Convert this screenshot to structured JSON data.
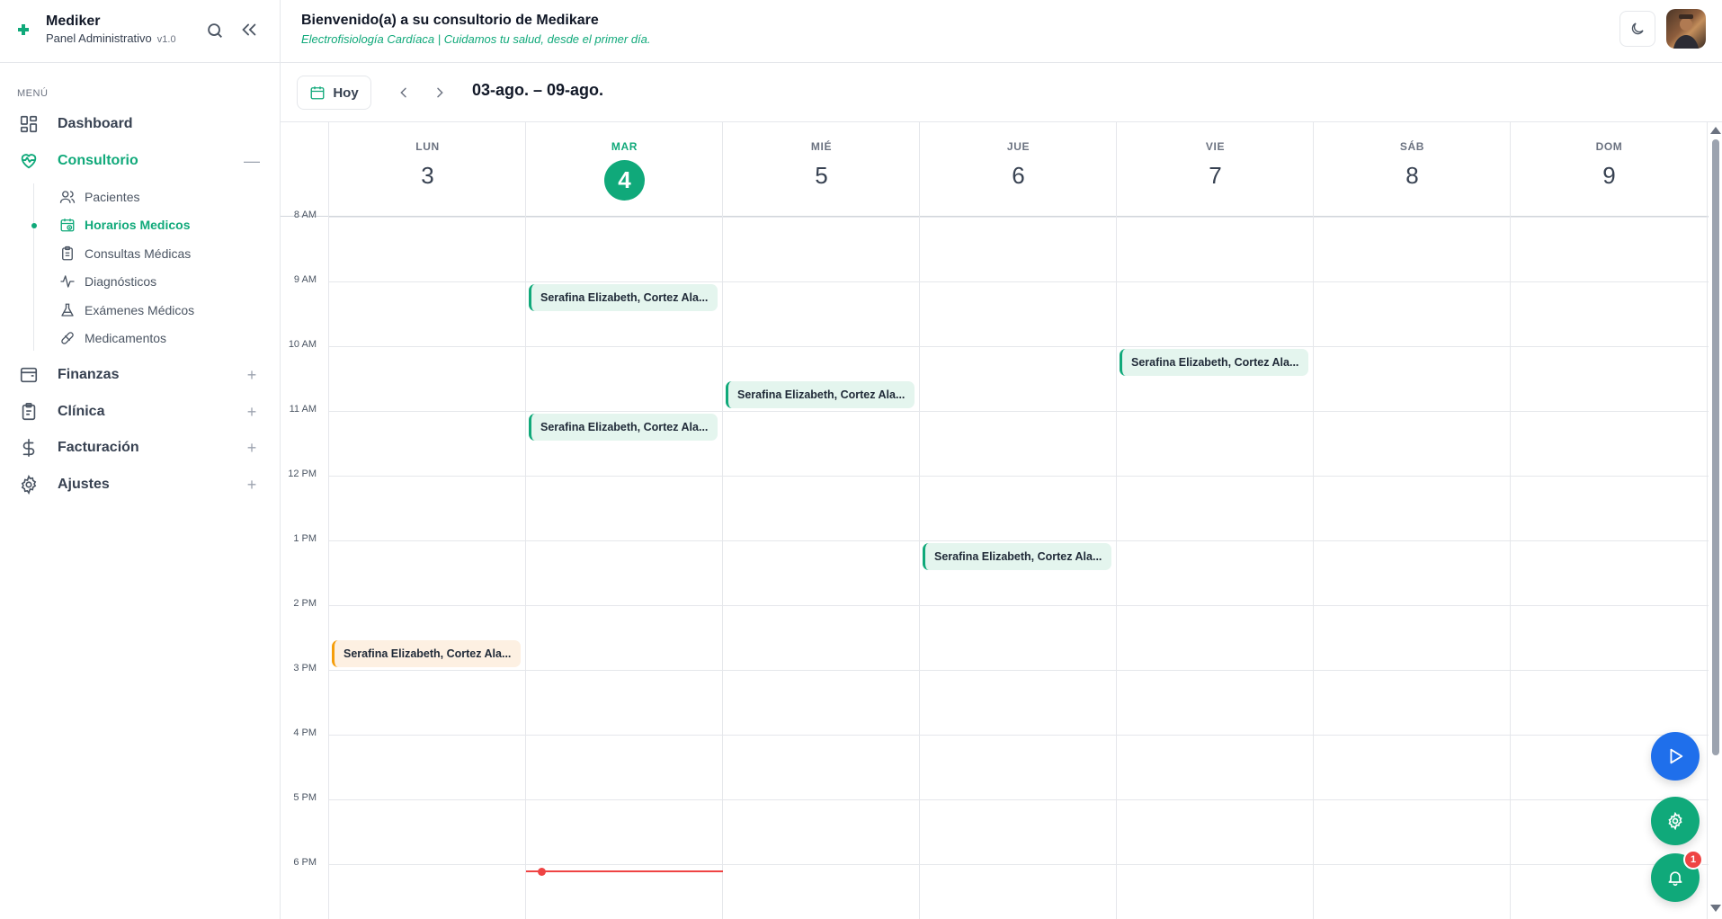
{
  "brand": {
    "name": "Mediker",
    "subtitle": "Panel Administrativo",
    "version": "v1.0"
  },
  "sidebar": {
    "menu_label": "MENÚ",
    "items": [
      {
        "label": "Dashboard",
        "icon": "dashboard-icon"
      },
      {
        "label": "Consultorio",
        "icon": "heart-pulse-icon",
        "toggle": "—"
      },
      {
        "label": "Finanzas",
        "icon": "wallet-icon",
        "toggle": "+"
      },
      {
        "label": "Clínica",
        "icon": "clipboard-icon",
        "toggle": "+"
      },
      {
        "label": "Facturación",
        "icon": "dollar-icon",
        "toggle": "+"
      },
      {
        "label": "Ajustes",
        "icon": "gear-icon",
        "toggle": "+"
      }
    ],
    "subitems": [
      {
        "label": "Pacientes",
        "icon": "users-icon"
      },
      {
        "label": "Horarios Medicos",
        "icon": "calendar-clock-icon"
      },
      {
        "label": "Consultas Médicas",
        "icon": "clipboard-list-icon"
      },
      {
        "label": "Diagnósticos",
        "icon": "activity-icon"
      },
      {
        "label": "Exámenes Médicos",
        "icon": "flask-icon"
      },
      {
        "label": "Medicamentos",
        "icon": "pill-icon"
      }
    ]
  },
  "header": {
    "title": "Bienvenido(a) a su consultorio de Medikare",
    "subtitle": "Electrofisiología Cardíaca | Cuidamos tu salud, desde el primer día."
  },
  "toolbar": {
    "today_label": "Hoy",
    "range": "03-ago. – 09-ago."
  },
  "calendar": {
    "days": [
      {
        "name": "LUN",
        "num": "3"
      },
      {
        "name": "MAR",
        "num": "4",
        "today": true
      },
      {
        "name": "MIÉ",
        "num": "5"
      },
      {
        "name": "JUE",
        "num": "6"
      },
      {
        "name": "VIE",
        "num": "7"
      },
      {
        "name": "SÁB",
        "num": "8"
      },
      {
        "name": "DOM",
        "num": "9"
      }
    ],
    "hours": [
      "8 AM",
      "9 AM",
      "10 AM",
      "11 AM",
      "12 PM",
      "1 PM",
      "2 PM",
      "3 PM",
      "4 PM",
      "5 PM",
      "6 PM"
    ],
    "events": [
      {
        "label": "Serafina Elizabeth, Cortez Ala...",
        "day": 1,
        "start": "9:00",
        "color": "green"
      },
      {
        "label": "Serafina Elizabeth, Cortez Ala...",
        "day": 4,
        "start": "10:00",
        "color": "green"
      },
      {
        "label": "Serafina Elizabeth, Cortez Ala...",
        "day": 2,
        "start": "10:30",
        "color": "green"
      },
      {
        "label": "Serafina Elizabeth, Cortez Ala...",
        "day": 1,
        "start": "11:00",
        "color": "green"
      },
      {
        "label": "Serafina Elizabeth, Cortez Ala...",
        "day": 3,
        "start": "13:00",
        "color": "green"
      },
      {
        "label": "Serafina Elizabeth, Cortez Ala...",
        "day": 0,
        "start": "14:30",
        "color": "orange"
      }
    ]
  },
  "notifications": {
    "count": "1"
  },
  "colors": {
    "accent": "#10a97a",
    "orange": "#f59e0b",
    "blue": "#1f6feb",
    "now": "#ef4444"
  }
}
